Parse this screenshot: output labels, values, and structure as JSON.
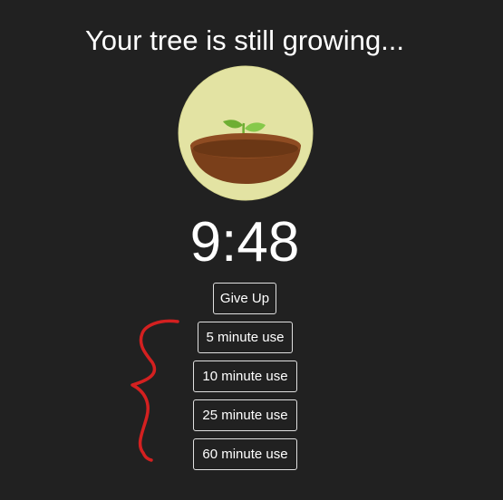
{
  "heading": "Your tree is still growing...",
  "timer": {
    "display": "9:48"
  },
  "buttons": {
    "give_up": "Give Up",
    "min5": "5 minute use",
    "min10": "10 minute use",
    "min25": "25 minute use",
    "min60": "60 minute use"
  },
  "colors": {
    "background": "#212121",
    "circle": "#e3e3a3",
    "pot": "#7a3f1a",
    "sprout": "#7cc242",
    "annotation": "#d42020"
  },
  "icons": {
    "tree": "sprout-in-pot-icon",
    "annotation": "red-curly-brace-annotation"
  }
}
